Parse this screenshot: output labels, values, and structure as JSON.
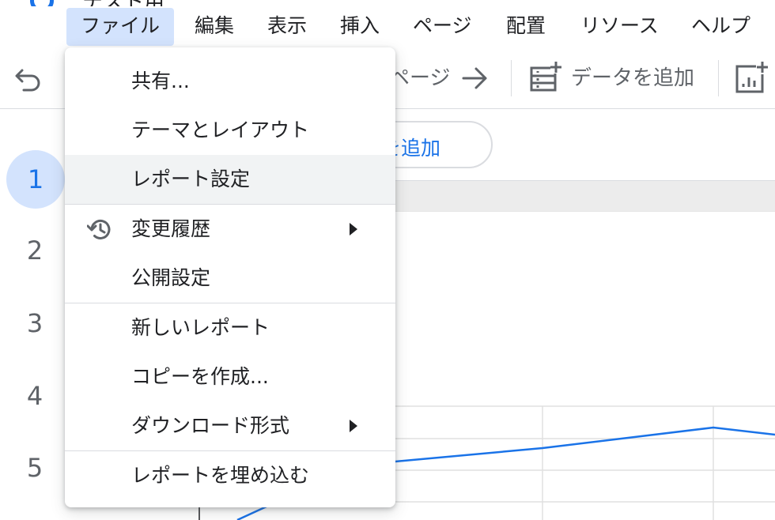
{
  "title": "テスト用",
  "menubar": {
    "items": [
      {
        "label": "ファイル",
        "active": true
      },
      {
        "label": "編集"
      },
      {
        "label": "表示"
      },
      {
        "label": "挿入"
      },
      {
        "label": "ページ"
      },
      {
        "label": "配置"
      },
      {
        "label": "リソース"
      },
      {
        "label": "ヘルプ"
      }
    ]
  },
  "toolbar": {
    "page_label": "ページ",
    "add_data_label": "データを追加"
  },
  "canvas": {
    "add_chip_label": "を追加"
  },
  "rail": {
    "pages": [
      "1",
      "2",
      "3",
      "4",
      "5"
    ],
    "active_page": "1"
  },
  "file_menu": {
    "items": [
      {
        "label": "共有..."
      },
      {
        "label": "テーマとレイアウト"
      },
      {
        "label": "レポート設定",
        "hovered": true
      },
      {
        "label": "変更履歴",
        "icon": "history-icon",
        "submenu": true
      },
      {
        "label": "公開設定"
      },
      {
        "label": "新しいレポート"
      },
      {
        "label": "コピーを作成..."
      },
      {
        "label": "ダウンロード形式",
        "submenu": true
      },
      {
        "label": "レポートを埋め込む"
      }
    ]
  },
  "colors": {
    "accent": "#1a73e8",
    "active_bg": "#d3e3fd",
    "hover_bg": "#f1f3f4",
    "divider": "#dadce0"
  }
}
